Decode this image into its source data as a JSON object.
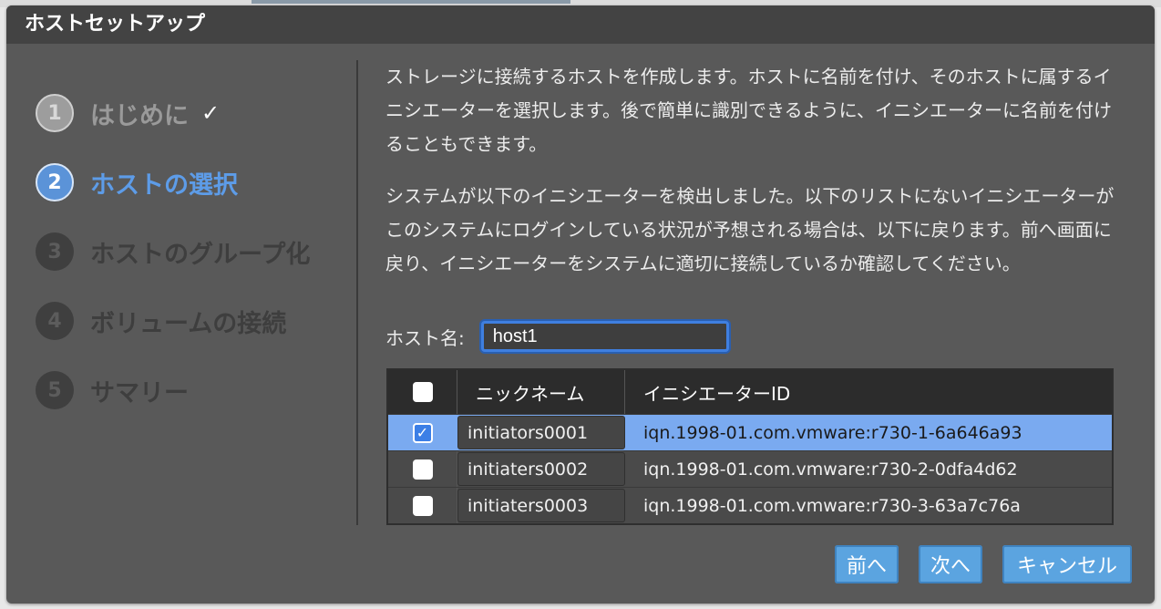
{
  "dialog": {
    "title": "ホストセットアップ"
  },
  "steps": [
    {
      "num": "1",
      "label": "はじめに",
      "state": "done",
      "check": "✓"
    },
    {
      "num": "2",
      "label": "ホストの選択",
      "state": "active"
    },
    {
      "num": "3",
      "label": "ホストのグループ化",
      "state": "pending"
    },
    {
      "num": "4",
      "label": "ボリュームの接続",
      "state": "pending"
    },
    {
      "num": "5",
      "label": "サマリー",
      "state": "pending"
    }
  ],
  "content": {
    "para1": "ストレージに接続するホストを作成します。ホストに名前を付け、そのホストに属するイニシエーターを選択します。後で簡単に識別できるように、イニシエーターに名前を付けることもできます。",
    "para2": "システムが以下のイニシエーターを検出しました。以下のリストにないイニシエーターがこのシステムにログインしている状況が予想される場合は、以下に戻ります。前へ画面に戻り、イニシエーターをシステムに適切に接続しているか確認してください。"
  },
  "host": {
    "label": "ホスト名:",
    "value": "host1"
  },
  "table": {
    "headers": {
      "nickname": "ニックネーム",
      "id": "イニシエーターID"
    },
    "rows": [
      {
        "nickname": "initiators0001",
        "id": "iqn.1998-01.com.vmware:r730-1-6a646a93",
        "checked": true
      },
      {
        "nickname": "initiaters0002",
        "id": "iqn.1998-01.com.vmware:r730-2-0dfa4d62",
        "checked": false
      },
      {
        "nickname": "initiaters0003",
        "id": "iqn.1998-01.com.vmware:r730-3-63a7c76a",
        "checked": false
      }
    ]
  },
  "buttons": {
    "prev": "前へ",
    "next": "次へ",
    "cancel": "キャンセル"
  },
  "colors": {
    "accent": "#5ba4e0",
    "selected_row": "#7aaaf0",
    "active_step": "#5d9ce8"
  }
}
